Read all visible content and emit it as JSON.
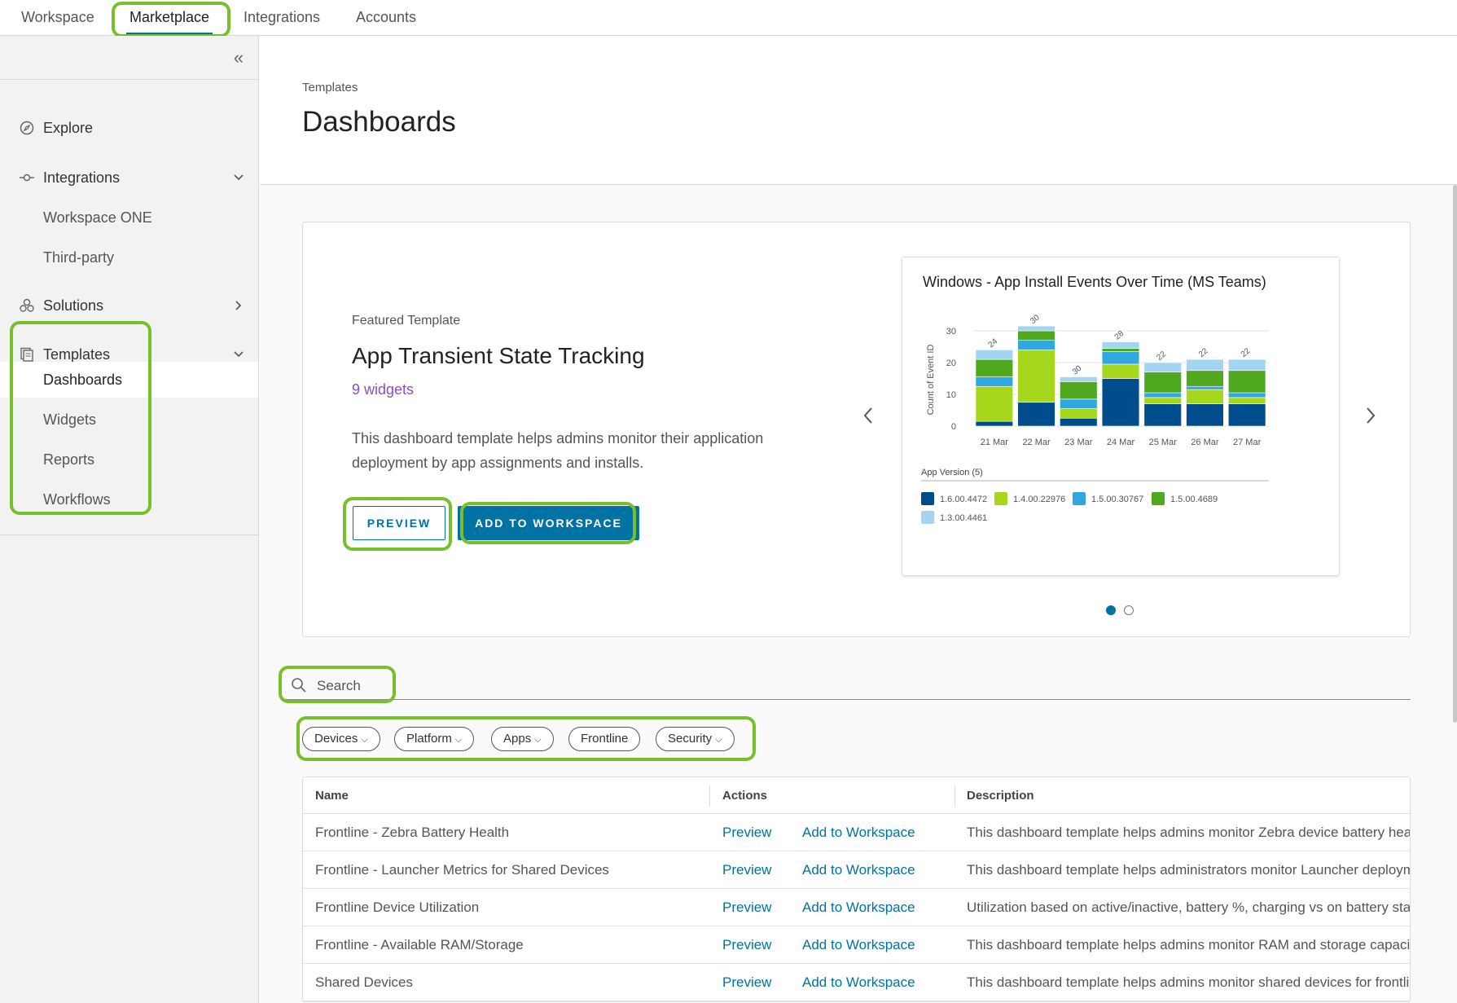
{
  "topnav": {
    "tabs": [
      "Workspace",
      "Marketplace",
      "Integrations",
      "Accounts"
    ],
    "active": "Marketplace"
  },
  "sidebar": {
    "collapse_icon": "double-chevron-left-icon",
    "explore": "Explore",
    "integrations": {
      "label": "Integrations",
      "children": [
        "Workspace ONE",
        "Third-party"
      ]
    },
    "solutions": "Solutions",
    "templates": {
      "label": "Templates",
      "children": [
        "Dashboards",
        "Widgets",
        "Reports",
        "Workflows"
      ],
      "active": "Dashboards"
    }
  },
  "header": {
    "breadcrumb": "Templates",
    "title": "Dashboards"
  },
  "featured": {
    "label": "Featured Template",
    "title": "App Transient State Tracking",
    "widget_count": "9 widgets",
    "description": "This dashboard template helps admins monitor their application deployment by app assignments and installs.",
    "preview_label": "PREVIEW",
    "add_label": "ADD TO WORKSPACE",
    "carousel_slide": 1,
    "carousel_total": 2
  },
  "chart_data": {
    "type": "bar",
    "stacked": true,
    "title": "Windows - App Install Events Over Time (MS Teams)",
    "ylabel": "Count of Event ID",
    "xlabel": "",
    "ylim": [
      0,
      30
    ],
    "yticks": [
      0,
      10,
      20,
      30
    ],
    "categories": [
      "21 Mar",
      "22 Mar",
      "23 Mar",
      "24 Mar",
      "25 Mar",
      "26 Mar",
      "27 Mar"
    ],
    "totals": [
      "24",
      "30",
      "30",
      "28",
      "22",
      "22",
      "22"
    ],
    "legend_title": "App Version (5)",
    "series": [
      {
        "name": "1.6.00.4472",
        "color": "#004c8c",
        "values": [
          1.5,
          7.5,
          2.5,
          15,
          7,
          7,
          7
        ]
      },
      {
        "name": "1.4.00.22976",
        "color": "#a6d71c",
        "values": [
          11,
          16.5,
          3,
          4.5,
          2,
          4.5,
          2
        ]
      },
      {
        "name": "1.5.00.30767",
        "color": "#31a7e2",
        "values": [
          3,
          3,
          3,
          4,
          1.5,
          1,
          1.5
        ]
      },
      {
        "name": "1.5.00.4689",
        "color": "#4fa81e",
        "values": [
          5.5,
          3,
          5.5,
          1,
          6.5,
          5,
          7
        ]
      },
      {
        "name": "1.3.00.4461",
        "color": "#a3d4f2",
        "values": [
          3,
          1.5,
          1.5,
          2,
          3,
          3.5,
          3.5
        ]
      }
    ]
  },
  "search": {
    "placeholder": "Search"
  },
  "filters": [
    "Devices",
    "Platform",
    "Apps",
    "Frontline",
    "Security"
  ],
  "table": {
    "headers": {
      "name": "Name",
      "actions": "Actions",
      "description": "Description"
    },
    "rows": [
      {
        "name": "Frontline - Zebra Battery Health",
        "preview": "Preview",
        "add": "Add to Workspace",
        "description": "This dashboard template helps admins monitor Zebra device battery health."
      },
      {
        "name": "Frontline - Launcher Metrics for Shared Devices",
        "preview": "Preview",
        "add": "Add to Workspace",
        "description": "This dashboard template helps administrators monitor Launcher deployments."
      },
      {
        "name": "Frontline Device Utilization",
        "preview": "Preview",
        "add": "Add to Workspace",
        "description": "Utilization based on active/inactive, battery %, charging vs on battery status."
      },
      {
        "name": "Frontline - Available RAM/Storage",
        "preview": "Preview",
        "add": "Add to Workspace",
        "description": "This dashboard template helps admins monitor RAM and storage capacity."
      },
      {
        "name": "Shared Devices",
        "preview": "Preview",
        "add": "Add to Workspace",
        "description": "This dashboard template helps admins monitor shared devices for frontline workers."
      }
    ]
  }
}
